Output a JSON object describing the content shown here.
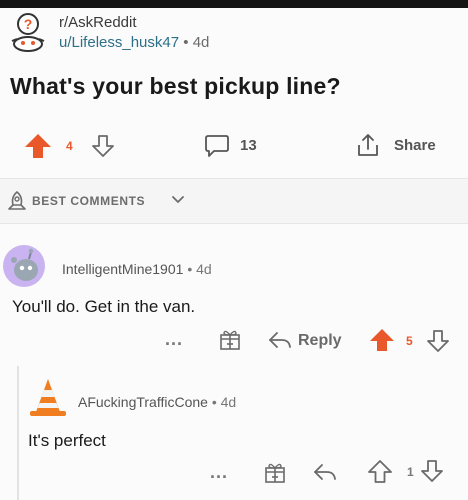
{
  "post": {
    "subreddit": "r/AskReddit",
    "author": "u/Lifeless_husk47",
    "separator": "•",
    "age": "4d",
    "title": "What's your best pickup line?",
    "votes": "4",
    "comments": "13",
    "share_label": "Share"
  },
  "sort": {
    "label": "BEST COMMENTS"
  },
  "comments": [
    {
      "author": "IntelligentMine1901",
      "separator": "•",
      "age": "4d",
      "body": "You'll do. Get in the van.",
      "more": "...",
      "reply_label": "Reply",
      "votes": "5"
    },
    {
      "author": "AFuckingTrafficCone",
      "separator": "•",
      "age": "4d",
      "body": "It's perfect",
      "more": "...",
      "votes": "1"
    }
  ],
  "colors": {
    "upvote": "#e8582a",
    "username_link": "#2c6f87",
    "icon_gray": "#6c6c6c",
    "snoo_purple": "#c9b3f0",
    "cone_orange": "#f07d1f"
  }
}
